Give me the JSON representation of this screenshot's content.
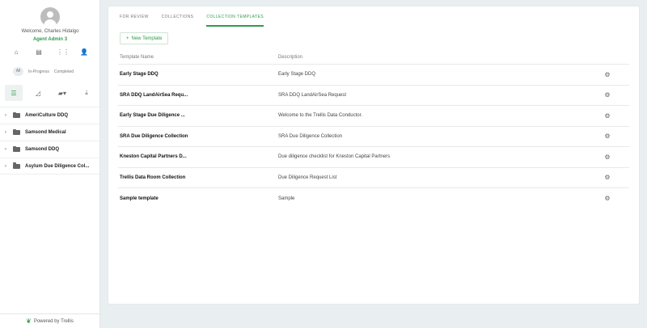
{
  "sidebar": {
    "welcome": "Welcome, Charles Hidalgo",
    "role": "Agent Admin 3",
    "nav_icons": [
      "home-icon",
      "document-icon",
      "apps-icon",
      "person-add-icon"
    ],
    "filters": {
      "count": "All",
      "in_progress": "In-Progress",
      "completed": "Completed"
    },
    "tools": [
      "list-icon",
      "chart-icon",
      "folder-add-icon",
      "download-icon"
    ],
    "folders": [
      {
        "name": "AmeriCulture DDQ"
      },
      {
        "name": "Samsond Medical"
      },
      {
        "name": "Samsond DDQ"
      },
      {
        "name": "Asylum Due Diligence Col..."
      }
    ],
    "powered_by": "Powered by Trellis"
  },
  "main": {
    "tabs": [
      {
        "label": "FOR REVIEW",
        "active": false
      },
      {
        "label": "COLLECTIONS",
        "active": false
      },
      {
        "label": "COLLECTION TEMPLATES",
        "active": true
      }
    ],
    "new_template_label": "New Template",
    "table": {
      "headers": {
        "name": "Template Name",
        "description": "Description"
      },
      "rows": [
        {
          "name": "Early Stage DDQ",
          "description": "Early Stage DDQ"
        },
        {
          "name": "SRA DDQ LandAirSea Requ...",
          "description": "SRA DDQ LandAirSea Request"
        },
        {
          "name": "Early Stage Due Diligence ...",
          "description": "Welcome to the Trellis Data Conductor."
        },
        {
          "name": "SRA Due Diligence Collection",
          "description": "SRA Due Diligence Collection"
        },
        {
          "name": "Kneston Capital Partners D...",
          "description": "Due diligence checklist for Kneston Capital Partners"
        },
        {
          "name": "Trellis Data Room Collection",
          "description": "Due Diligence Request List"
        },
        {
          "name": "Sample template",
          "description": "Sample"
        }
      ]
    }
  },
  "colors": {
    "accent": "#2e9b48",
    "background": "#e9eef0"
  }
}
